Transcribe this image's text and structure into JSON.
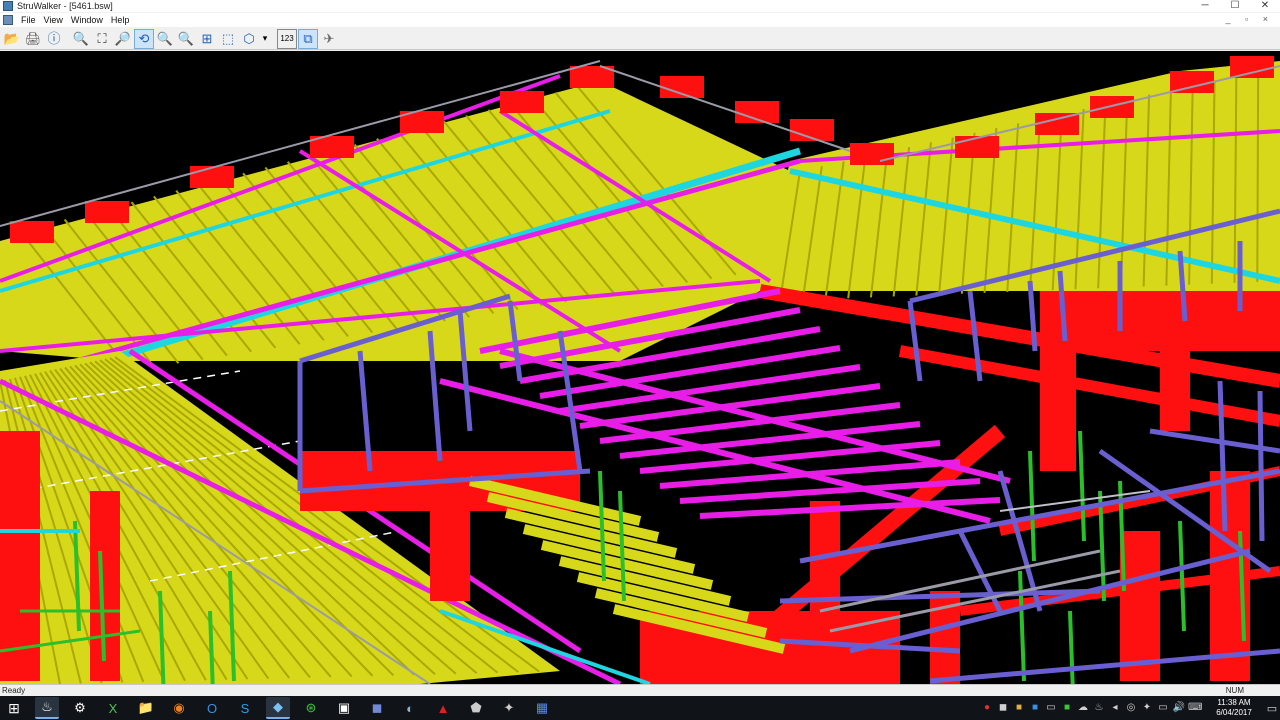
{
  "window": {
    "title": "StruWalker - [5461.bsw]",
    "controls": [
      "─",
      "☐",
      "✕"
    ],
    "mdi_controls": "_ ▫ ×"
  },
  "menu": {
    "items": [
      "File",
      "View",
      "Window",
      "Help"
    ]
  },
  "toolbar": {
    "buttons": [
      {
        "name": "open-icon",
        "glyph": "📂"
      },
      {
        "name": "print-icon",
        "glyph": "🖨"
      },
      {
        "name": "info-icon",
        "glyph": "ⓘ"
      },
      {
        "name": "zoom-in-icon",
        "glyph": "🔍"
      },
      {
        "name": "zoom-window-icon",
        "glyph": "⛶"
      },
      {
        "name": "zoom-extents-icon",
        "glyph": "🔎"
      },
      {
        "name": "orbit-icon",
        "glyph": "⟲"
      },
      {
        "name": "pan-zoom-icon",
        "glyph": "🔍"
      },
      {
        "name": "zoom-out-icon",
        "glyph": "🔍"
      },
      {
        "name": "box-select-icon",
        "glyph": "⊞"
      },
      {
        "name": "section-box-icon",
        "glyph": "⬚"
      },
      {
        "name": "3d-view-icon",
        "glyph": "⬡"
      },
      {
        "name": "dropdown-icon",
        "glyph": "▾"
      },
      {
        "name": "numbering-icon",
        "glyph": "123"
      },
      {
        "name": "clip-icon",
        "glyph": "⧉"
      },
      {
        "name": "walk-icon",
        "glyph": "✈"
      }
    ]
  },
  "model": {
    "colors": {
      "deck_yellow": "#d8d81a",
      "deck_yellow_dark": "#a9a800",
      "purlin_cyan": "#1ed6e0",
      "beam_magenta": "#e81ee8",
      "frame_red": "#ff1010",
      "brace_blue": "#6a5fd0",
      "column_green": "#2bbf2b",
      "rail_grey": "#9a9aa8"
    }
  },
  "status": {
    "left": "Ready",
    "right": "NUM"
  },
  "taskbar": {
    "apps": [
      {
        "name": "windows-start-icon",
        "glyph": "⊞"
      },
      {
        "name": "steam-icon",
        "glyph": "♨"
      },
      {
        "name": "app-settings-icon",
        "glyph": "⚙"
      },
      {
        "name": "excel-icon",
        "glyph": "X"
      },
      {
        "name": "file-explorer-icon",
        "glyph": "📁"
      },
      {
        "name": "firefox-icon",
        "glyph": "◉"
      },
      {
        "name": "outlook-icon",
        "glyph": "O"
      },
      {
        "name": "skype-icon",
        "glyph": "S"
      },
      {
        "name": "struwalker-icon",
        "glyph": "◆"
      },
      {
        "name": "xbox-icon",
        "glyph": "⊛"
      },
      {
        "name": "terminal-icon",
        "glyph": "▣"
      },
      {
        "name": "discord-icon",
        "glyph": "◼"
      },
      {
        "name": "media-icon",
        "glyph": "◐"
      },
      {
        "name": "acrobat-icon",
        "glyph": "▲"
      },
      {
        "name": "security-icon",
        "glyph": "⬟"
      },
      {
        "name": "tools-icon",
        "glyph": "✦"
      },
      {
        "name": "viewer-icon",
        "glyph": "▦"
      }
    ],
    "clock_time": "11:38 AM",
    "clock_date": "6/04/2017"
  }
}
